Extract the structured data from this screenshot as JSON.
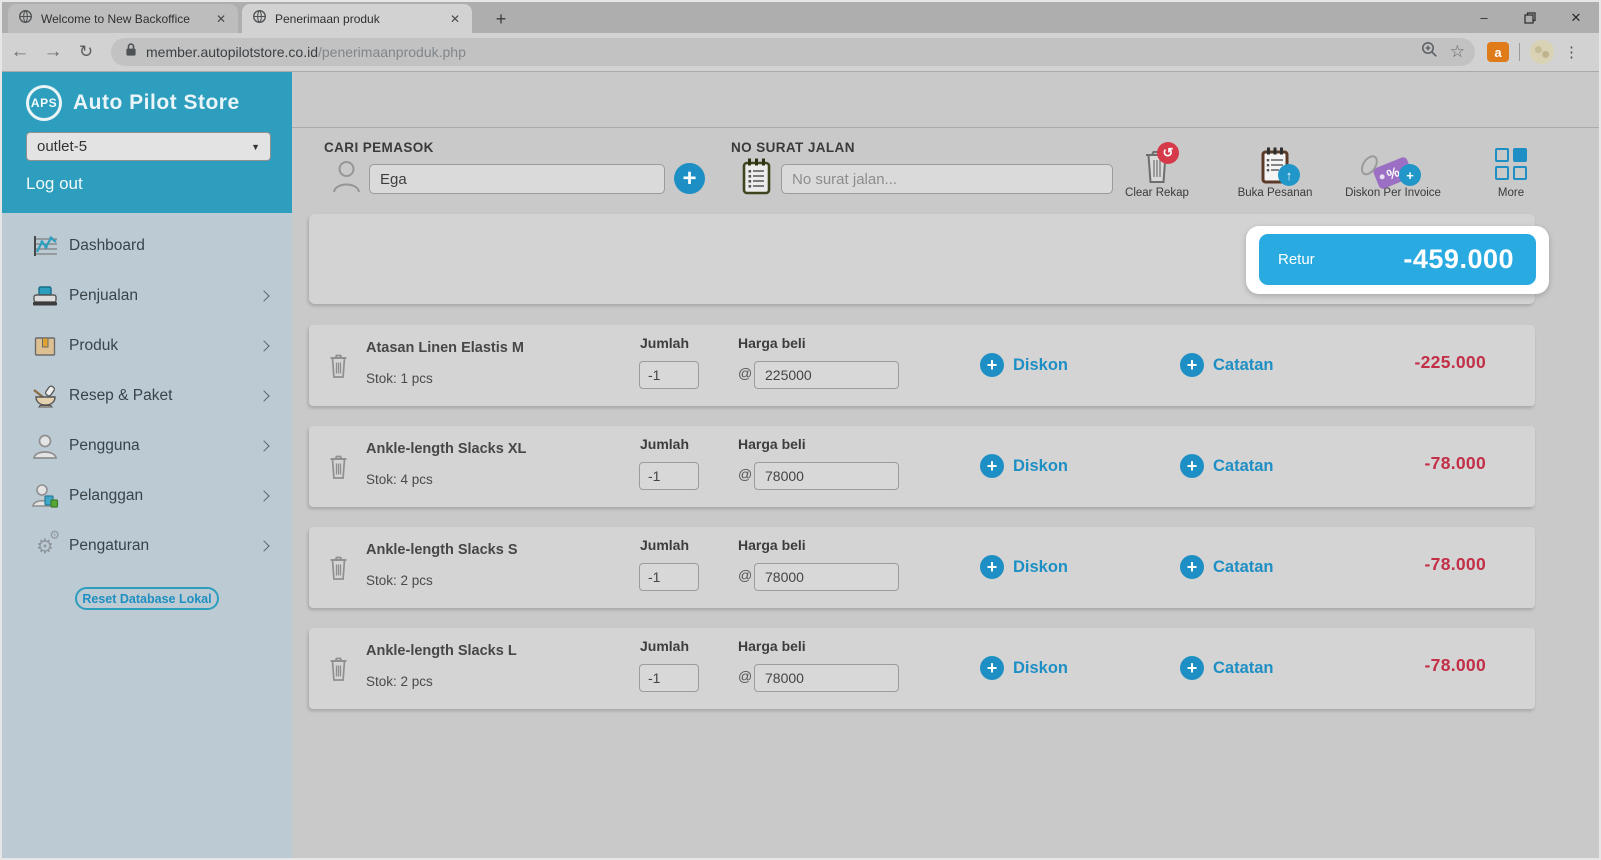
{
  "browser": {
    "tabs": [
      {
        "title": "Welcome to New Backoffice",
        "active": false
      },
      {
        "title": "Penerimaan produk",
        "active": true
      }
    ],
    "url": {
      "domain": "member.autopilotstore.co.id",
      "path": "/penerimaanproduk.php"
    }
  },
  "icons": {
    "plus": "+",
    "minimize": "–",
    "close_window": "✕",
    "close_tab": "✕",
    "new_tab": "+",
    "back": "←",
    "forward": "→",
    "reload": "↻",
    "star": "☆",
    "kebab": "⋮",
    "caret_down": "▼",
    "undo": "↺",
    "upload": "↑",
    "percent": "%",
    "gear": "⚙",
    "extension_letter": "a"
  },
  "sidebar": {
    "logo_text": "APS",
    "brand": "Auto Pilot Store",
    "outlet": "outlet-5",
    "logout": "Log out",
    "menu": [
      {
        "label": "Dashboard",
        "icon": "dashboard-chart-icon",
        "has_submenu": false
      },
      {
        "label": "Penjualan",
        "icon": "cash-register-icon",
        "has_submenu": true
      },
      {
        "label": "Produk",
        "icon": "product-box-icon",
        "has_submenu": true
      },
      {
        "label": "Resep & Paket",
        "icon": "mortar-pestle-icon",
        "has_submenu": true
      },
      {
        "label": "Pengguna",
        "icon": "user-icon",
        "has_submenu": true
      },
      {
        "label": "Pelanggan",
        "icon": "customer-bag-icon",
        "has_submenu": true
      },
      {
        "label": "Pengaturan",
        "icon": "gears-icon",
        "has_submenu": true
      }
    ],
    "reset_label": "Reset Database Lokal"
  },
  "toolbar": {
    "supplier_label": "CARI PEMASOK",
    "supplier_value": "Ega",
    "surat_label": "NO SURAT JALAN",
    "surat_placeholder": "No surat jalan...",
    "actions": [
      {
        "label": "Clear Rekap",
        "icon": "trash-undo-icon"
      },
      {
        "label": "Buka Pesanan",
        "icon": "clipboard-upload-icon"
      },
      {
        "label": "Diskon Per Invoice",
        "icon": "discount-tag-plus-icon"
      },
      {
        "label": "More",
        "icon": "grid-more-icon"
      }
    ]
  },
  "summary": {
    "retur_label": "Retur",
    "retur_amount": "-459.000"
  },
  "row_labels": {
    "jumlah": "Jumlah",
    "harga": "Harga beli",
    "at": "@",
    "diskon": "Diskon",
    "catatan": "Catatan"
  },
  "items": [
    {
      "name": "Atasan Linen Elastis M",
      "stock": "Stok: 1 pcs",
      "qty": "-1",
      "price": "225000",
      "total": "-225.000"
    },
    {
      "name": "Ankle-length Slacks XL",
      "stock": "Stok: 4 pcs",
      "qty": "-1",
      "price": "78000",
      "total": "-78.000"
    },
    {
      "name": "Ankle-length Slacks S",
      "stock": "Stok: 2 pcs",
      "qty": "-1",
      "price": "78000",
      "total": "-78.000"
    },
    {
      "name": "Ankle-length Slacks L",
      "stock": "Stok: 2 pcs",
      "qty": "-1",
      "price": "78000",
      "total": "-78.000"
    }
  ],
  "colors": {
    "sidebar_teal": "#2d9ebd",
    "accent_blue": "#1e8fc4",
    "retur_blue": "#29abe2",
    "negative_red": "#c22f47",
    "page_bg": "#c9c9c9",
    "panel_bg": "#d4d4d4",
    "spotlight": "#ffffff"
  }
}
